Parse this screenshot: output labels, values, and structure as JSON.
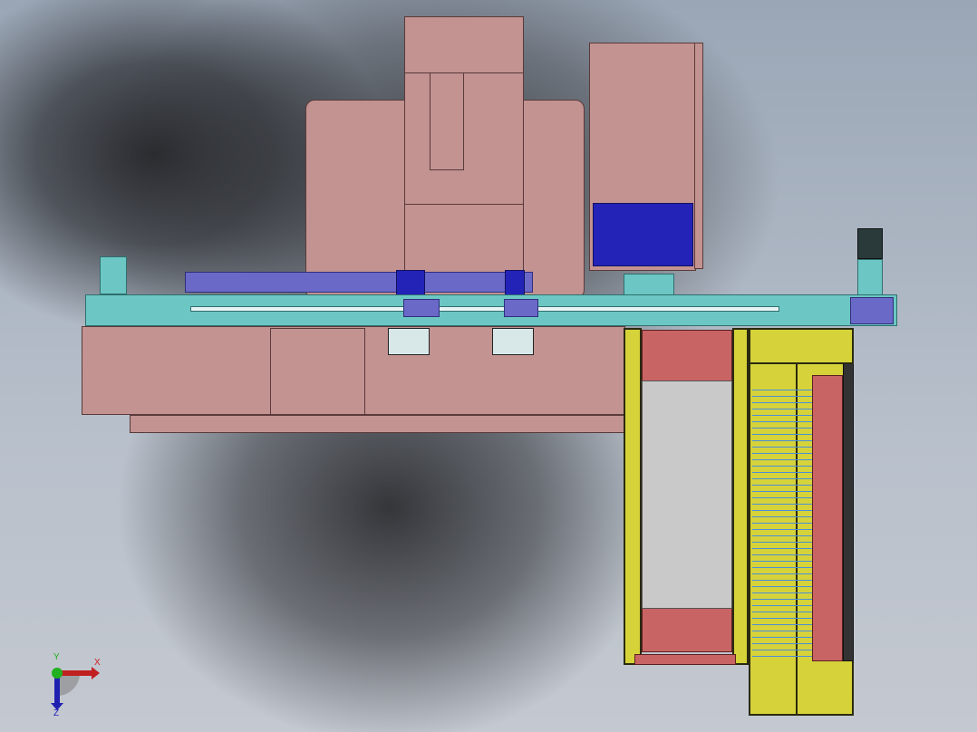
{
  "viewport": {
    "background": "#b8c0cb"
  },
  "triad": {
    "x_label": "X",
    "y_label": "Y",
    "z_label": "Z",
    "colors": {
      "x": "#d02020",
      "y": "#20b020",
      "z": "#2020c0"
    }
  }
}
